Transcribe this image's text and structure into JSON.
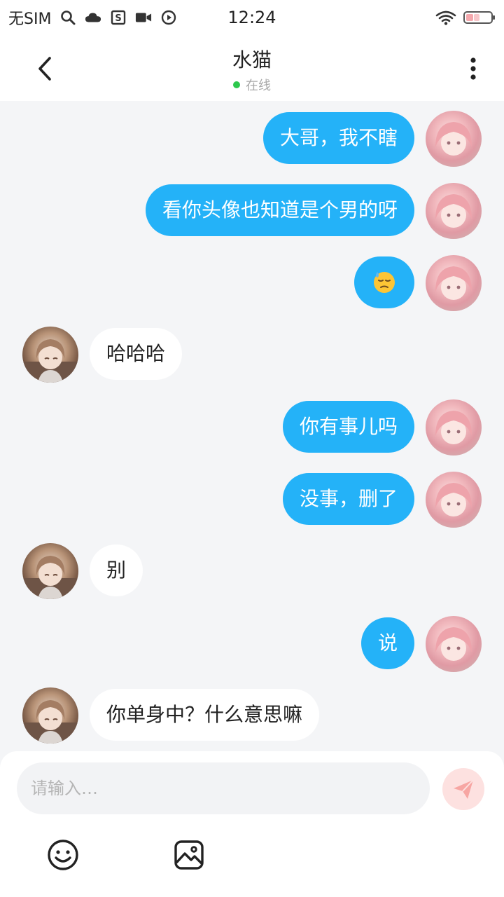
{
  "status_bar": {
    "carrier": "无SIM",
    "time": "12:24",
    "icons": [
      "search-icon",
      "cloud-icon",
      "s-app-icon",
      "video-icon",
      "record-icon",
      "wifi-icon",
      "battery-icon"
    ]
  },
  "header": {
    "title": "水猫",
    "status": "在线",
    "status_color": "#2dc84d"
  },
  "messages": [
    {
      "sender": "me",
      "text": "大哥，我不瞎"
    },
    {
      "sender": "me",
      "text": "看你头像也知道是个男的呀"
    },
    {
      "sender": "me",
      "text": "",
      "emoji": "downcast-face-with-sweat"
    },
    {
      "sender": "other",
      "text": "哈哈哈"
    },
    {
      "sender": "me",
      "text": "你有事儿吗"
    },
    {
      "sender": "me",
      "text": "没事，删了"
    },
    {
      "sender": "other",
      "text": "别"
    },
    {
      "sender": "me",
      "text": "说"
    },
    {
      "sender": "other",
      "text": "你单身中？什么意思嘛"
    }
  ],
  "composer": {
    "placeholder": "请输入…",
    "value": ""
  },
  "colors": {
    "my_bubble": "#24b2f8",
    "other_bubble": "#ffffff",
    "background": "#f4f5f7",
    "send_button": "#fde1e0",
    "send_icon": "#f7a6a3"
  }
}
